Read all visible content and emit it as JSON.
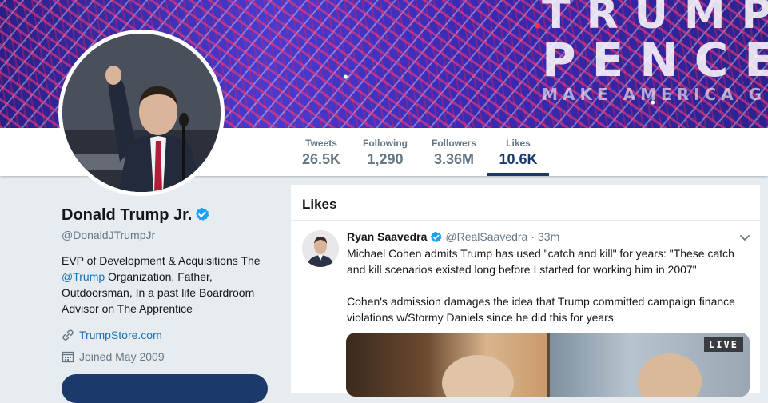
{
  "banner": {
    "line1": "TRUMP",
    "line2": "PENCE",
    "line3": "MAKE AMERICA G"
  },
  "stats": {
    "tweets": {
      "label": "Tweets",
      "value": "26.5K"
    },
    "following": {
      "label": "Following",
      "value": "1,290"
    },
    "followers": {
      "label": "Followers",
      "value": "3.36M"
    },
    "likes": {
      "label": "Likes",
      "value": "10.6K"
    }
  },
  "profile": {
    "name": "Donald Trump Jr.",
    "handle": "@DonaldJTrumpJr",
    "bio_part1": "EVP of Development & Acquisitions The ",
    "bio_link": "@Trump",
    "bio_part2": " Organization, Father, Outdoorsman, In a past life Boardroom Advisor on The Apprentice",
    "website": "TrumpStore.com",
    "joined": "Joined May 2009"
  },
  "timeline": {
    "header": "Likes",
    "tweet": {
      "author": "Ryan Saavedra",
      "handle": "@RealSaavedra",
      "separator": "·",
      "time": "33m",
      "text_p1": "Michael Cohen admits Trump has used \"catch and kill\" for years: \"These catch and kill scenarios existed long before I started for working him in 2007\"",
      "text_p2": "Cohen's admission damages the idea that Trump committed campaign finance violations w/Stormy Daniels since he did this for years",
      "media_badge": "LIVE"
    }
  },
  "colors": {
    "accent": "#1b3a6b",
    "link": "#1b6fb5",
    "verified": "#1da1f2",
    "muted": "#657786",
    "page_bg": "#e6ecf0"
  },
  "icons": {
    "verified": "verified-badge-icon",
    "website": "link-icon",
    "joined": "calendar-icon",
    "tweet_menu": "chevron-down-icon"
  }
}
